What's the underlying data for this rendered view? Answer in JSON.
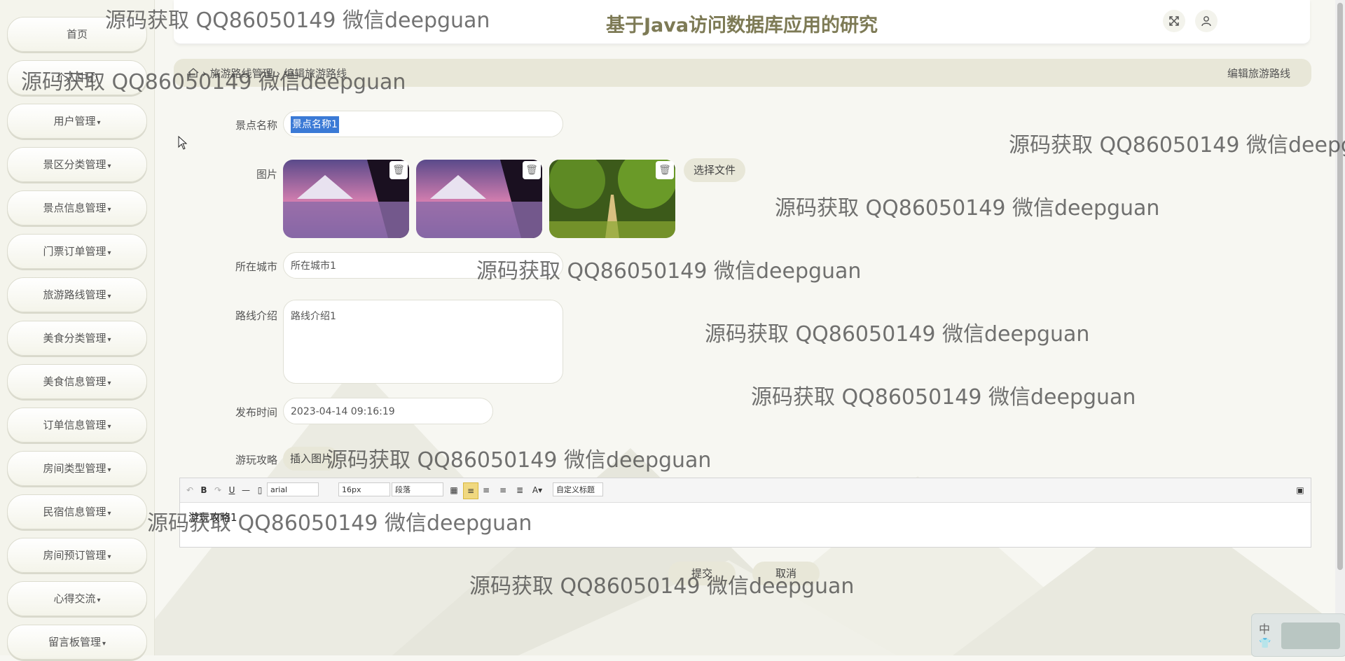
{
  "header": {
    "title": "基于Java访问数据库应用的研究",
    "fullscreen_icon": "expand-icon",
    "user_icon": "user-icon"
  },
  "sidebar": {
    "items": [
      {
        "label": "首页",
        "has_caret": false
      },
      {
        "label": "个人中心",
        "has_caret": false
      },
      {
        "label": "用户管理",
        "has_caret": true
      },
      {
        "label": "景区分类管理",
        "has_caret": true
      },
      {
        "label": "景点信息管理",
        "has_caret": true
      },
      {
        "label": "门票订单管理",
        "has_caret": true
      },
      {
        "label": "旅游路线管理",
        "has_caret": true
      },
      {
        "label": "美食分类管理",
        "has_caret": true
      },
      {
        "label": "美食信息管理",
        "has_caret": true
      },
      {
        "label": "订单信息管理",
        "has_caret": true
      },
      {
        "label": "房间类型管理",
        "has_caret": true
      },
      {
        "label": "民宿信息管理",
        "has_caret": true
      },
      {
        "label": "房间预订管理",
        "has_caret": true
      },
      {
        "label": "心得交流",
        "has_caret": true
      },
      {
        "label": "留言板管理",
        "has_caret": true
      }
    ],
    "caret": "▾"
  },
  "breadcrumb": {
    "home_icon": "home-icon",
    "separator": "›",
    "path": "旅游路线管理",
    "current": "编辑旅游路线",
    "right_title": "编辑旅游路线"
  },
  "form": {
    "scenic_label": "景点名称",
    "scenic_value": "景点名称1",
    "images_label": "图片",
    "choose_file": "选择文件",
    "city_label": "所在城市",
    "city_value": "所在城市1",
    "intro_label": "路线介绍",
    "intro_value": "路线介绍1",
    "time_label": "发布时间",
    "time_value": "2023-04-14 09:16:19",
    "guide_label": "游玩攻略",
    "insert_image": "插入图片",
    "editor": {
      "font": "arial",
      "size": "16px",
      "paragraph": "段落",
      "custom_title": "自定义标题",
      "content": "游玩攻略1"
    },
    "submit": "提交",
    "cancel": "取消"
  },
  "watermark": "源码获取 QQ86050149 微信deepguan",
  "ime": {
    "char": "中"
  }
}
